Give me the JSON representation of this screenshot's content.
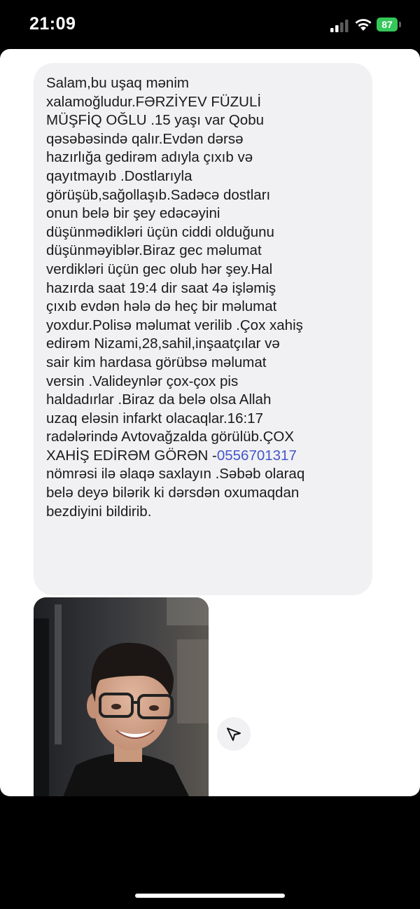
{
  "status_bar": {
    "time": "21:09",
    "battery": "87"
  },
  "message": {
    "text": "Salam,bu uşaq mənim\nxalamoğludur.FƏRZİYEV FÜZULİ\nMÜŞFİQ OĞLU .15 yaşı var Qobu\nqəsəbəsində qalır.Evdən dərsə\nhazırlığa gedirəm adıyla çıxıb və\nqayıtmayıb .Dostlarıyla\ngörüşüb,sağollaşıb.Sadəcə dostları\nonun belə bir şey edəcəyini\ndüşünmədikləri üçün ciddi olduğunu\ndüşünməyiblər.Biraz gec məlumat\nverdikləri üçün gec olub hər şey.Hal\nhazırda saat 19:4 dir saat 4ə işləmiş\nçıxıb evdən hələ də heç bir məlumat\nyoxdur.Polisə məlumat verilib .Çox xahiş\nedirəm Nizami,28,sahil,inşaatçılar və\nsair kim hardasa görübsə məlumat\nversin .Valideynlər çox-çox pis\nhaldadırlar .Biraz da belə olsa Allah\nuzaq eləsin infarkt olacaqlar.16:17\nradələrində Avtovağzalda görülüb.ÇOX\nXAHİŞ EDİRƏM GÖRƏN  -",
    "phone": "0556701317",
    "text_after": "\nnömrəsi ilə əlaqə saxlayın .Səbəb olaraq\nbelə deyə bilərik ki dərsdən oxumaqdan\nbezdiyini bildirib.",
    "link_color": "#4457c9"
  },
  "icons": {
    "share": "paper-plane-icon",
    "signal": "cellular-signal-icon",
    "wifi": "wifi-icon",
    "battery": "battery-icon"
  },
  "colors": {
    "bubble": "#f1f1f3",
    "battery": "#34c759"
  }
}
